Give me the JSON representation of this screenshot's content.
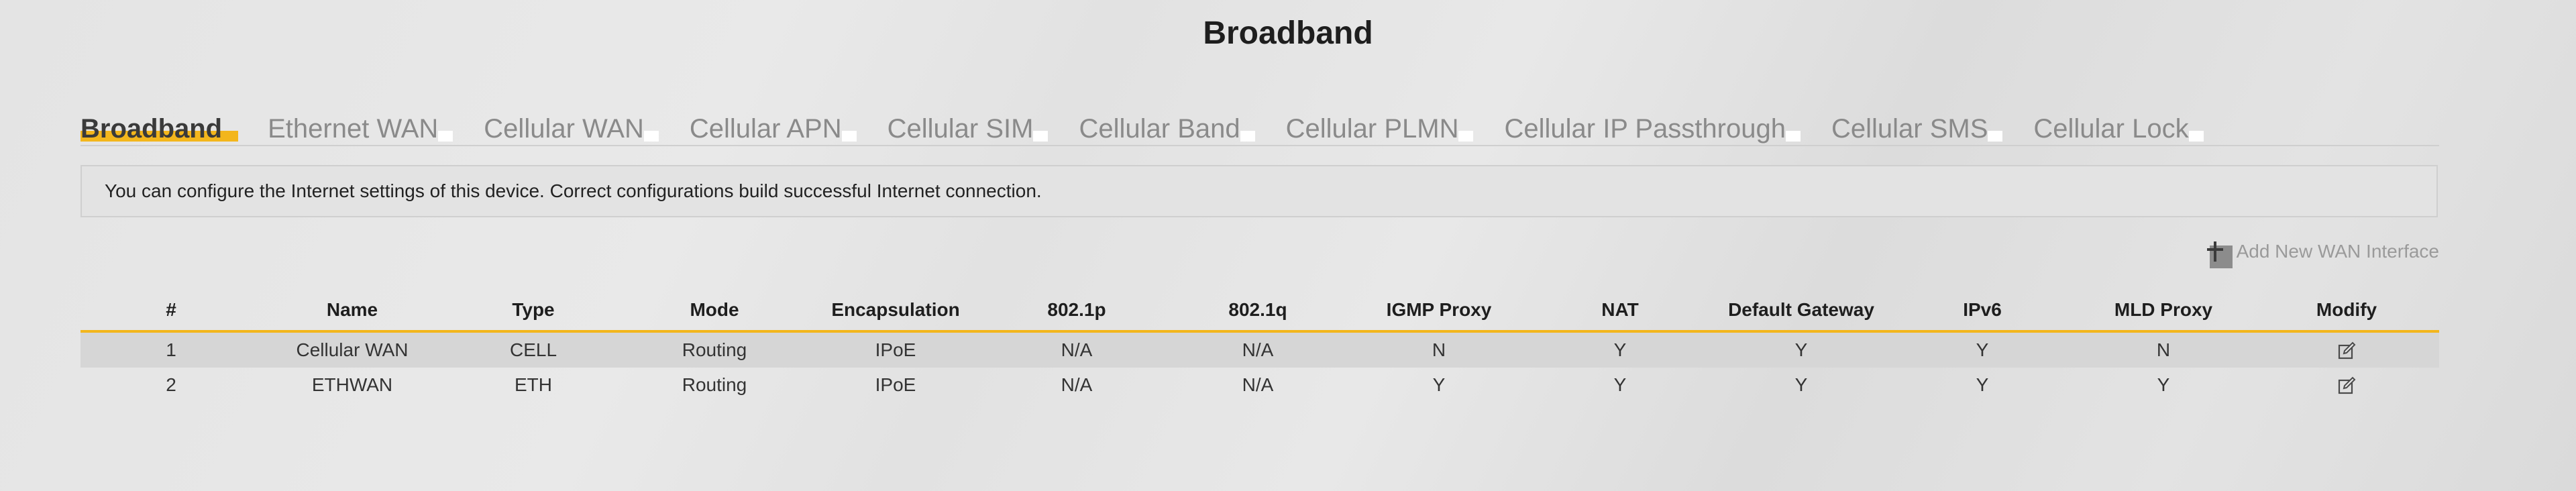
{
  "page": {
    "title": "Broadband"
  },
  "tabs": [
    {
      "label": "Broadband",
      "active": true
    },
    {
      "label": "Ethernet WAN"
    },
    {
      "label": "Cellular WAN"
    },
    {
      "label": "Cellular APN"
    },
    {
      "label": "Cellular SIM"
    },
    {
      "label": "Cellular Band"
    },
    {
      "label": "Cellular PLMN"
    },
    {
      "label": "Cellular IP Passthrough"
    },
    {
      "label": "Cellular SMS"
    },
    {
      "label": "Cellular Lock"
    }
  ],
  "info": "You can configure the Internet settings of this device. Correct configurations build successful Internet connection.",
  "add_button": {
    "label": "Add New WAN Interface",
    "icon": "plus-icon"
  },
  "table": {
    "headers": [
      "#",
      "Name",
      "Type",
      "Mode",
      "Encapsulation",
      "802.1p",
      "802.1q",
      "IGMP Proxy",
      "NAT",
      "Default Gateway",
      "IPv6",
      "MLD Proxy",
      "Modify"
    ],
    "rows": [
      [
        "1",
        "Cellular WAN",
        "CELL",
        "Routing",
        "IPoE",
        "N/A",
        "N/A",
        "N",
        "Y",
        "Y",
        "Y",
        "N"
      ],
      [
        "2",
        "ETHWAN",
        "ETH",
        "Routing",
        "IPoE",
        "N/A",
        "N/A",
        "Y",
        "Y",
        "Y",
        "Y",
        "Y"
      ]
    ]
  },
  "colors": {
    "accent": "#f3b61c",
    "tab_inactive": "#8a8a8a"
  }
}
